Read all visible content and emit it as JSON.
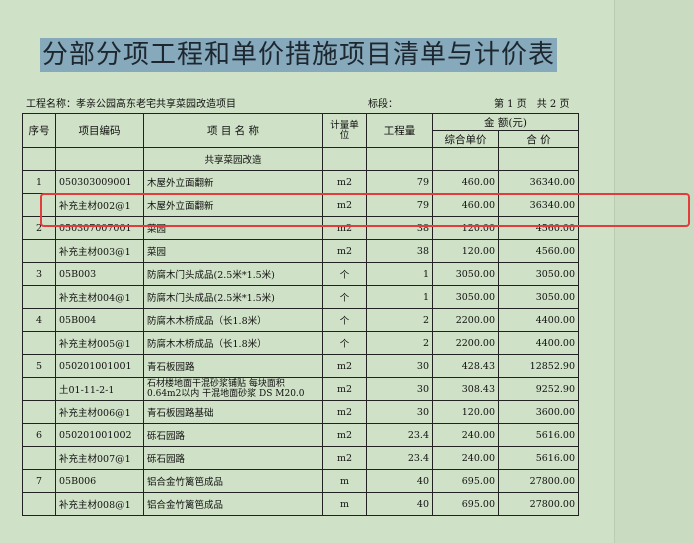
{
  "title": "分部分项工程和单价措施项目清单与计价表",
  "meta": {
    "project": "工程名称：孝亲公园高东老宅共享菜园改造项目",
    "section": "标段：",
    "page": "第 1 页　共 2 页"
  },
  "headers": {
    "seq": "序号",
    "code": "项目编码",
    "name": "项 目 名 称",
    "unit": "计量单位",
    "qty": "工程量",
    "amount": "金 额(元)",
    "unit_price": "综合单价",
    "total": "合 价"
  },
  "section_title": "共享菜园改造",
  "rows": [
    {
      "seq": "1",
      "code": "050303009001",
      "name": "木屋外立面翻新",
      "unit": "m2",
      "qty": "79",
      "price": "460.00",
      "total": "36340.00"
    },
    {
      "seq": "",
      "code": "补充主材002@1",
      "name": "木屋外立面翻新",
      "unit": "m2",
      "qty": "79",
      "price": "460.00",
      "total": "36340.00"
    },
    {
      "seq": "2",
      "code": "050307007001",
      "name": "菜园",
      "unit": "m2",
      "qty": "38",
      "price": "120.00",
      "total": "4560.00"
    },
    {
      "seq": "",
      "code": "补充主材003@1",
      "name": "菜园",
      "unit": "m2",
      "qty": "38",
      "price": "120.00",
      "total": "4560.00"
    },
    {
      "seq": "3",
      "code": "05B003",
      "name": "防腐木门头成品(2.5米*1.5米)",
      "unit": "个",
      "qty": "1",
      "price": "3050.00",
      "total": "3050.00"
    },
    {
      "seq": "",
      "code": "补充主材004@1",
      "name": "防腐木门头成品(2.5米*1.5米)",
      "unit": "个",
      "qty": "1",
      "price": "3050.00",
      "total": "3050.00"
    },
    {
      "seq": "4",
      "code": "05B004",
      "name": "防腐木木桥成品（长1.8米）",
      "unit": "个",
      "qty": "2",
      "price": "2200.00",
      "total": "4400.00"
    },
    {
      "seq": "",
      "code": "补充主材005@1",
      "name": "防腐木木桥成品（长1.8米）",
      "unit": "个",
      "qty": "2",
      "price": "2200.00",
      "total": "4400.00"
    },
    {
      "seq": "5",
      "code": "050201001001",
      "name": "青石板园路",
      "unit": "m2",
      "qty": "30",
      "price": "428.43",
      "total": "12852.90"
    },
    {
      "seq": "",
      "code": "土01-11-2-1",
      "name": "石材楼地面干混砂浆铺贴 每块面积 0.64m2以内 干混地面砂浆 DS M20.0",
      "unit": "m2",
      "qty": "30",
      "price": "308.43",
      "total": "9252.90"
    },
    {
      "seq": "",
      "code": "补充主材006@1",
      "name": "青石板园路基础",
      "unit": "m2",
      "qty": "30",
      "price": "120.00",
      "total": "3600.00"
    },
    {
      "seq": "6",
      "code": "050201001002",
      "name": "砾石园路",
      "unit": "m2",
      "qty": "23.4",
      "price": "240.00",
      "total": "5616.00"
    },
    {
      "seq": "",
      "code": "补充主材007@1",
      "name": "砾石园路",
      "unit": "m2",
      "qty": "23.4",
      "price": "240.00",
      "total": "5616.00"
    },
    {
      "seq": "7",
      "code": "05B006",
      "name": "铝合金竹篱笆成品",
      "unit": "m",
      "qty": "40",
      "price": "695.00",
      "total": "27800.00"
    },
    {
      "seq": "",
      "code": "补充主材008@1",
      "name": "铝合金竹篱笆成品",
      "unit": "m",
      "qty": "40",
      "price": "695.00",
      "total": "27800.00"
    }
  ]
}
